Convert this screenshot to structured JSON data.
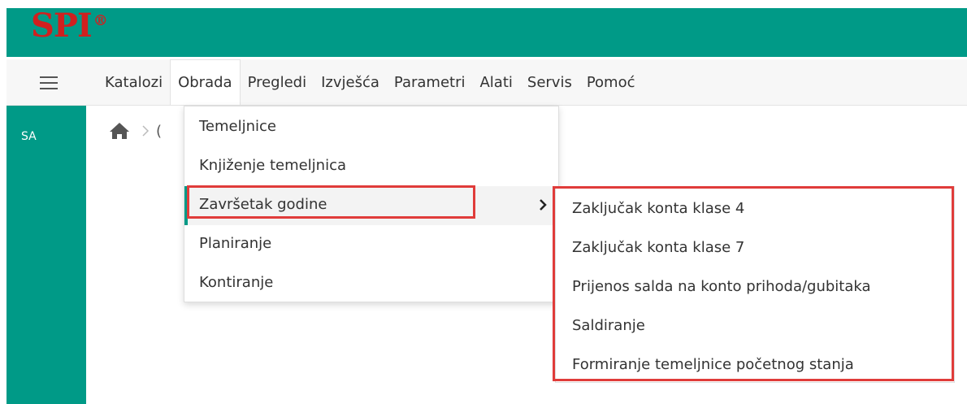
{
  "app": {
    "logo": "SPI",
    "logo_mark": "®",
    "accent": "#009a87",
    "logo_color": "#d0201f",
    "highlight_color": "#e03c3a"
  },
  "menubar": {
    "items": [
      {
        "label": "Katalozi"
      },
      {
        "label": "Obrada"
      },
      {
        "label": "Pregledi"
      },
      {
        "label": "Izvješća"
      },
      {
        "label": "Parametri"
      },
      {
        "label": "Alati"
      },
      {
        "label": "Servis"
      },
      {
        "label": "Pomoć"
      }
    ],
    "active": "Obrada"
  },
  "sidebar": {
    "user_initials": "SA"
  },
  "breadcrumb": {
    "partial_text": "("
  },
  "obrada_menu": {
    "items": [
      {
        "label": "Temeljnice"
      },
      {
        "label": "Knjiženje temeljnica"
      },
      {
        "label": "Završetak godine"
      },
      {
        "label": "Planiranje"
      },
      {
        "label": "Kontiranje"
      }
    ],
    "hovered": "Završetak godine"
  },
  "zavrsetak_submenu": {
    "items": [
      {
        "label": "Zaključak konta klase 4"
      },
      {
        "label": "Zaključak konta klase 7"
      },
      {
        "label": "Prijenos salda na konto prihoda/gubitaka"
      },
      {
        "label": "Saldiranje"
      },
      {
        "label": "Formiranje temeljnice početnog stanja"
      }
    ]
  },
  "icons": {
    "menu": "hamburger-icon",
    "home": "home-icon",
    "separator": "chevron-right-icon",
    "submenu_arrow": "chevron-right-icon"
  }
}
